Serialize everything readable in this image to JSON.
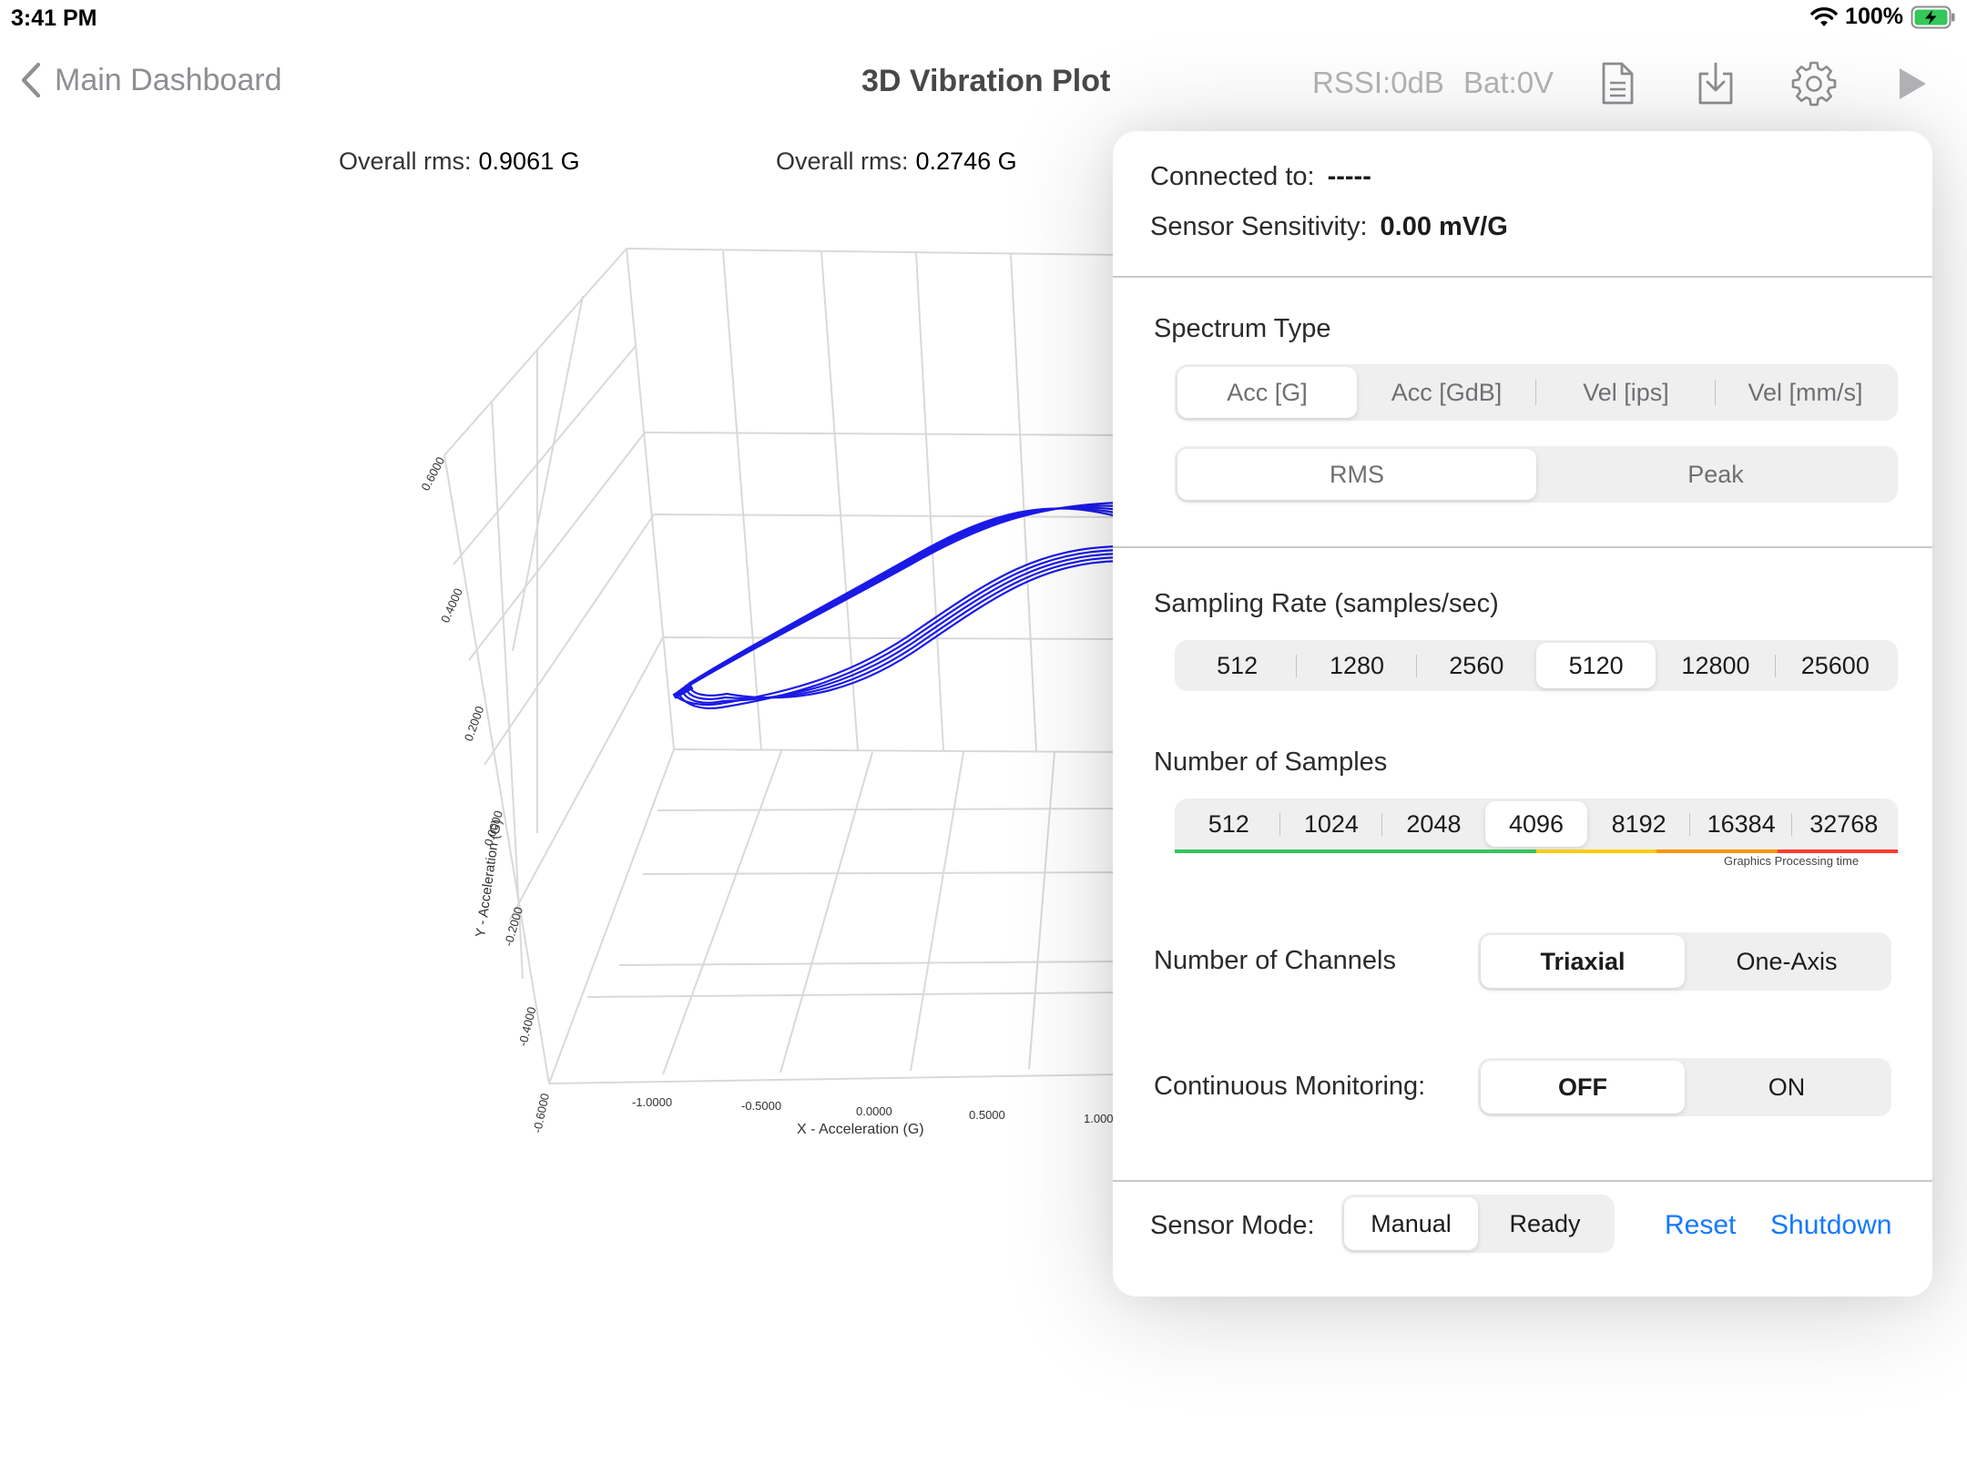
{
  "status": {
    "time": "3:41 PM",
    "battery": "100%"
  },
  "nav": {
    "back_label": "Main Dashboard",
    "title": "3D Vibration Plot",
    "rssi": "RSSI:0dB",
    "bat": "Bat:0V"
  },
  "plot": {
    "rms1_label": "Overall rms:",
    "rms1_value": "0.9061 G",
    "rms2_label": "Overall rms:",
    "rms2_value": "0.2746 G",
    "x_label": "X - Acceleration (G)",
    "y_label": "Y - Acceleration (G)",
    "x_ticks": [
      "-1.0000",
      "-0.5000",
      "0.0000",
      "0.5000",
      "1.000"
    ],
    "z_ticks": [
      "0.6000",
      "0.4000",
      "0.2000",
      "0.0000",
      "-0.2000",
      "-0.4000",
      "-0.6000"
    ],
    "trace_color": "#1a1ae6"
  },
  "settings": {
    "connected_label": "Connected to:",
    "connected_value": "-----",
    "sensitivity_label": "Sensor Sensitivity:",
    "sensitivity_value": "0.00 mV/G",
    "spectrum_type": {
      "label": "Spectrum Type",
      "options": [
        "Acc [G]",
        "Acc [GdB]",
        "Vel [ips]",
        "Vel [mm/s]"
      ],
      "selected": "Acc [G]"
    },
    "amplitude": {
      "options": [
        "RMS",
        "Peak"
      ],
      "selected": "RMS"
    },
    "sampling_rate": {
      "label": "Sampling Rate (samples/sec)",
      "options": [
        "512",
        "1280",
        "2560",
        "5120",
        "12800",
        "25600"
      ],
      "selected": "5120"
    },
    "num_samples": {
      "label": "Number of Samples",
      "options": [
        "512",
        "1024",
        "2048",
        "4096",
        "8192",
        "16384",
        "32768"
      ],
      "selected": "4096",
      "note": "Graphics Processing time",
      "colors": {
        "good": "#34c759",
        "medium": "#ffcc00",
        "slow": "#ff9500",
        "bad": "#ff3b30"
      }
    },
    "channels": {
      "label": "Number of Channels",
      "options": [
        "Triaxial",
        "One-Axis"
      ],
      "selected": "Triaxial"
    },
    "continuous": {
      "label": "Continuous Monitoring:",
      "options": [
        "OFF",
        "ON"
      ],
      "selected": "OFF"
    },
    "sensor_mode": {
      "label": "Sensor Mode:",
      "options": [
        "Manual",
        "Ready"
      ],
      "selected": "Manual"
    },
    "reset_label": "Reset",
    "shutdown_label": "Shutdown"
  }
}
